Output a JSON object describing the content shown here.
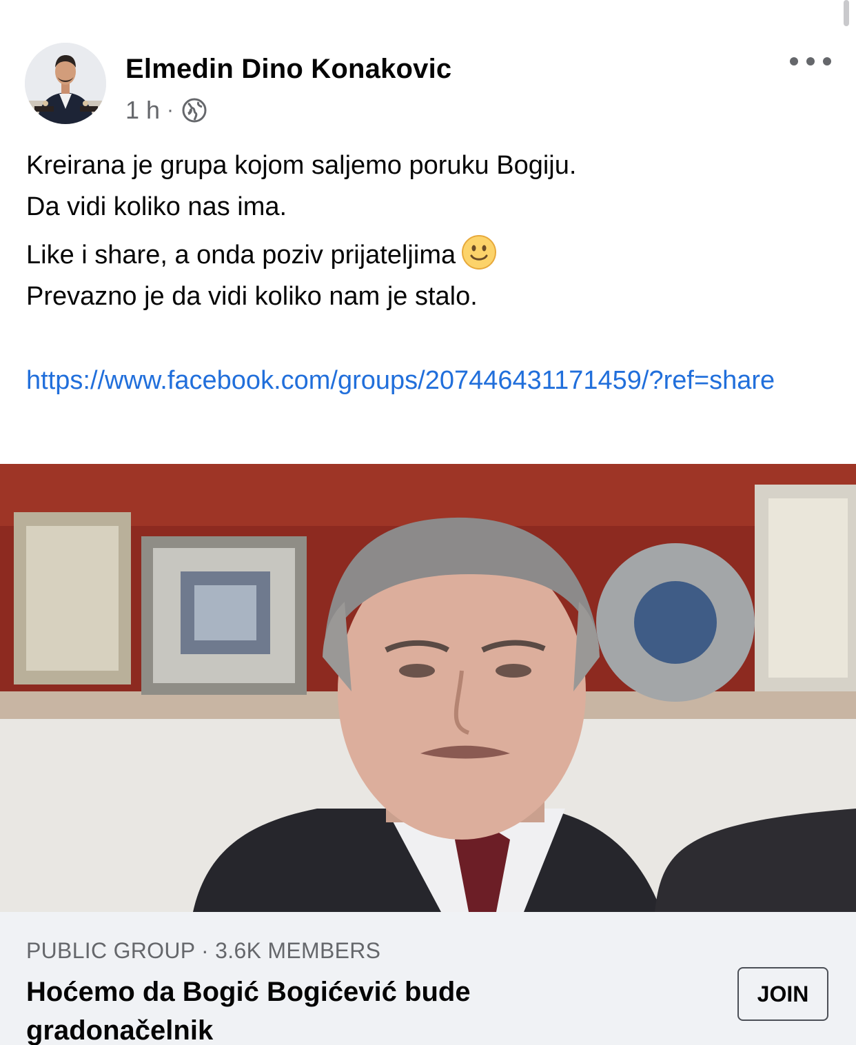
{
  "post": {
    "author": "Elmedin Dino Konakovic",
    "time": "1 h",
    "separator": "·",
    "privacy_icon": "globe-icon",
    "more_icon": "more-options-icon",
    "text_lines_1": [
      "Kreirana je grupa kojom saljemo poruku Bogiju.",
      "Da vidi koliko nas ima."
    ],
    "text_line_3": "Like i share, a onda poziv prijateljima",
    "emoji": "slightly-smiling-face-icon",
    "text_line_4": "Prevazno je da vidi koliko nam je stalo.",
    "link": "https://www.facebook.com/groups/207446431171459/?ref=share"
  },
  "link_card": {
    "meta": "PUBLIC GROUP · 3.6K MEMBERS",
    "title": "Hoćemo da Bogić Bogićević bude gradonačelnik",
    "join_label": "JOIN"
  },
  "colors": {
    "link": "#216fdb",
    "secondary_text": "#65676b",
    "card_background": "#f0f2f5"
  }
}
